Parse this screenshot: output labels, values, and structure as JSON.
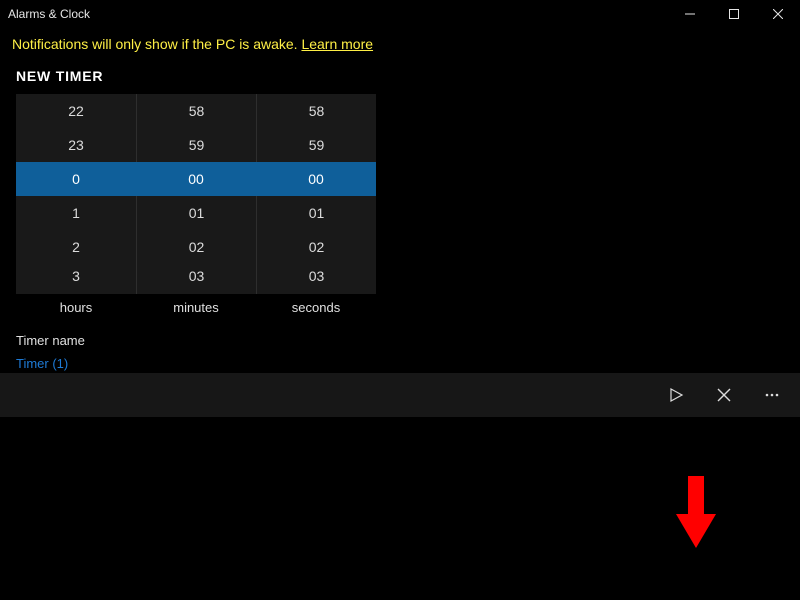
{
  "window": {
    "title": "Alarms & Clock"
  },
  "notification": {
    "text": "Notifications will only show if the PC is awake.",
    "link_label": "Learn more"
  },
  "timer": {
    "heading": "NEW TIMER",
    "picker": {
      "hours": {
        "minus2": "22",
        "minus1": "23",
        "selected": "0",
        "plus1": "1",
        "plus2": "2",
        "plus3": "3"
      },
      "minutes": {
        "minus2": "58",
        "minus1": "59",
        "selected": "00",
        "plus1": "01",
        "plus2": "02",
        "plus3": "03"
      },
      "seconds": {
        "minus2": "58",
        "minus1": "59",
        "selected": "00",
        "plus1": "01",
        "plus2": "02",
        "plus3": "03"
      }
    },
    "labels": {
      "hours": "hours",
      "minutes": "minutes",
      "seconds": "seconds"
    },
    "name_label": "Timer name",
    "name_value": "Timer (1)"
  },
  "commands": {
    "start": "Start",
    "cancel": "Cancel",
    "more": "More"
  }
}
